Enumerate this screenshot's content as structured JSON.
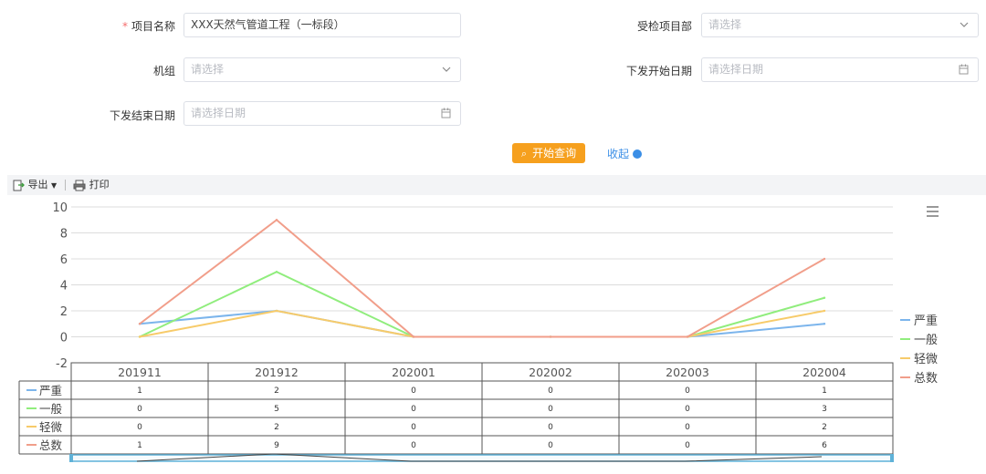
{
  "form": {
    "project_name_label": "项目名称",
    "project_name_value": "XXX天然气管道工程（一标段）",
    "inspected_dept_label": "受检项目部",
    "inspected_dept_placeholder": "请选择",
    "crew_label": "机组",
    "crew_placeholder": "请选择",
    "issue_start_label": "下发开始日期",
    "issue_start_placeholder": "请选择日期",
    "issue_end_label": "下发结束日期",
    "issue_end_placeholder": "请选择日期"
  },
  "actions": {
    "query_label": "开始查询",
    "collapse_label": "收起"
  },
  "toolbar": {
    "export_label": "导出",
    "print_label": "打印"
  },
  "chart_data": {
    "type": "line",
    "categories": [
      "201911",
      "201912",
      "202001",
      "202002",
      "202003",
      "202004"
    ],
    "ylim": [
      -2,
      10
    ],
    "yticks": [
      10,
      8,
      6,
      4,
      2,
      0,
      -2
    ],
    "grid": true,
    "legend": "right",
    "series": [
      {
        "name": "严重",
        "color": "#7cb5ec",
        "values": [
          1,
          2,
          0,
          0,
          0,
          1
        ]
      },
      {
        "name": "一般",
        "color": "#90ed7d",
        "values": [
          0,
          5,
          0,
          0,
          0,
          3
        ]
      },
      {
        "name": "轻微",
        "color": "#f7cb6a",
        "values": [
          0,
          2,
          0,
          0,
          0,
          2
        ]
      },
      {
        "name": "总数",
        "color": "#f19e8a",
        "values": [
          1,
          9,
          0,
          0,
          0,
          6
        ]
      }
    ]
  }
}
